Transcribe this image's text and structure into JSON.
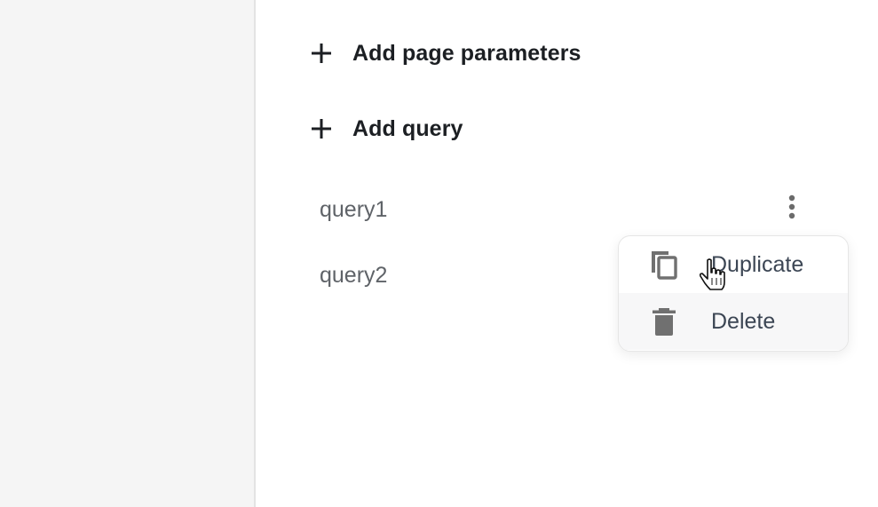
{
  "actions": {
    "add_page_parameters": "Add page parameters",
    "add_query": "Add query"
  },
  "queries": [
    {
      "name": "query1"
    },
    {
      "name": "query2"
    }
  ],
  "context_menu": {
    "items": [
      {
        "label": "Duplicate",
        "icon": "copy-icon"
      },
      {
        "label": "Delete",
        "icon": "trash-icon"
      }
    ]
  },
  "icons": {
    "plus": "plus-icon",
    "more": "more-vertical-icon",
    "cursor": "hand-pointer-cursor"
  },
  "colors": {
    "sidebar_bg": "#f5f5f5",
    "text_dark": "#1c1f23",
    "text_muted": "#5f6368",
    "menu_text": "#3c4654",
    "icon_gray": "#707070"
  }
}
